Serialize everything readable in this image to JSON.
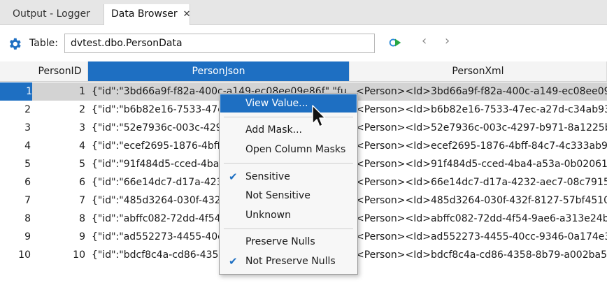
{
  "tabs": [
    {
      "label": "Output - Logger"
    },
    {
      "label": "Data Browser",
      "close": "✕"
    }
  ],
  "toolbar": {
    "table_label": "Table:",
    "table_value": "dvtest.dbo.PersonData",
    "prev": "‹",
    "next": "›"
  },
  "grid": {
    "columns": [
      "PersonID",
      "PersonJson",
      "PersonXml"
    ],
    "rows": [
      {
        "num": "1",
        "id": "1",
        "json": "{\"id\":\"3bd66a9f-f82a-400c-a149-ec08ee09e86f\",\"full_n",
        "xml": "<Person><Id>3bd66a9f-f82a-400c-a149-ec08ee09e86"
      },
      {
        "num": "2",
        "id": "2",
        "json": "{\"id\":\"b6b82e16-7533-47ec",
        "xml": "<Person><Id>b6b82e16-7533-47ec-a27d-c34ab935dc"
      },
      {
        "num": "3",
        "id": "3",
        "json": "{\"id\":\"52e7936c-003c-4297-",
        "xml": "<Person><Id>52e7936c-003c-4297-b971-8a1225b255"
      },
      {
        "num": "4",
        "id": "4",
        "json": "{\"id\":\"ecef2695-1876-4bff-8",
        "xml": "<Person><Id>ecef2695-1876-4bff-84c7-4c333ab9ed1"
      },
      {
        "num": "5",
        "id": "5",
        "json": "{\"id\":\"91f484d5-cced-4ba4-",
        "xml": "<Person><Id>91f484d5-cced-4ba4-a53a-0b02061b6e"
      },
      {
        "num": "6",
        "id": "6",
        "json": "{\"id\":\"66e14dc7-d17a-4232",
        "xml": "<Person><Id>66e14dc7-d17a-4232-aec7-08c7915219"
      },
      {
        "num": "7",
        "id": "7",
        "json": "{\"id\":\"485d3264-030f-432f-",
        "xml": "<Person><Id>485d3264-030f-432f-8127-57bf45100e4"
      },
      {
        "num": "8",
        "id": "8",
        "json": "{\"id\":\"abffc082-72dd-4f54-9",
        "xml": "<Person><Id>abffc082-72dd-4f54-9ae6-a313e24bf61"
      },
      {
        "num": "9",
        "id": "9",
        "json": "{\"id\":\"ad552273-4455-40cc-",
        "xml": "<Person><Id>ad552273-4455-40cc-9346-0a174e3bb4"
      },
      {
        "num": "10",
        "id": "10",
        "json": "{\"id\":\"bdcf8c4a-cd86-4358-",
        "xml": "<Person><Id>bdcf8c4a-cd86-4358-8b79-a002ba5d20"
      }
    ]
  },
  "menu": {
    "view_value": "View Value...",
    "add_mask": "Add Mask...",
    "open_masks": "Open Column Masks",
    "sensitive": "Sensitive",
    "not_sensitive": "Not Sensitive",
    "unknown": "Unknown",
    "preserve_nulls": "Preserve Nulls",
    "not_preserve_nulls": "Not Preserve Nulls",
    "check": "✔"
  },
  "colors": {
    "accent": "#1e6fc2",
    "selected_row": "#d3d3d3",
    "run_icon": "#28a745"
  }
}
